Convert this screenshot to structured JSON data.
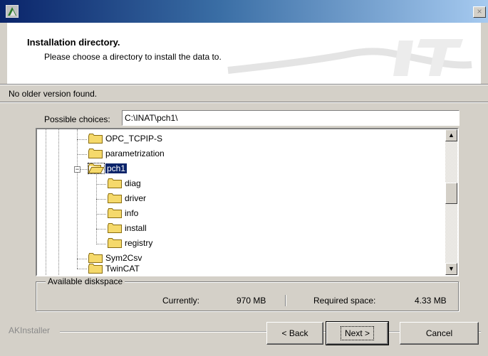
{
  "window": {
    "close_glyph": "×"
  },
  "header": {
    "title": "Installation directory.",
    "subtitle": "Please choose a directory to install the data to."
  },
  "status": {
    "message": "No older version found."
  },
  "path": {
    "label": "Possible choices:",
    "value": "C:\\INAT\\pch1\\"
  },
  "tree": {
    "items": [
      {
        "label": "OPC_TCPIP-S"
      },
      {
        "label": "parametrization"
      },
      {
        "label": "pch1",
        "expanded": true,
        "selected": true
      },
      {
        "label": "diag"
      },
      {
        "label": "driver"
      },
      {
        "label": "info"
      },
      {
        "label": "install"
      },
      {
        "label": "registry"
      },
      {
        "label": "Sym2Csv"
      },
      {
        "label": "TwinCAT"
      }
    ],
    "expander_glyph": "−",
    "scroll_up_glyph": "▲",
    "scroll_down_glyph": "▼"
  },
  "disk": {
    "legend": "Available diskspace",
    "current_label": "Currently:",
    "current_value": "970 MB",
    "required_label": "Required space:",
    "required_value": "4.33 MB"
  },
  "footer": {
    "brand": "AKInstaller",
    "back_label": "< Back",
    "next_label": "Next >",
    "cancel_label": "Cancel"
  },
  "colors": {
    "titlebar_start": "#0a246a",
    "titlebar_end": "#a6caf0",
    "selection": "#0a246a",
    "folder": "#f5d96b"
  },
  "icons": [
    "installer-icon",
    "close-icon",
    "folder-icon",
    "folder-open-icon",
    "scroll-up-icon",
    "scroll-down-icon"
  ]
}
